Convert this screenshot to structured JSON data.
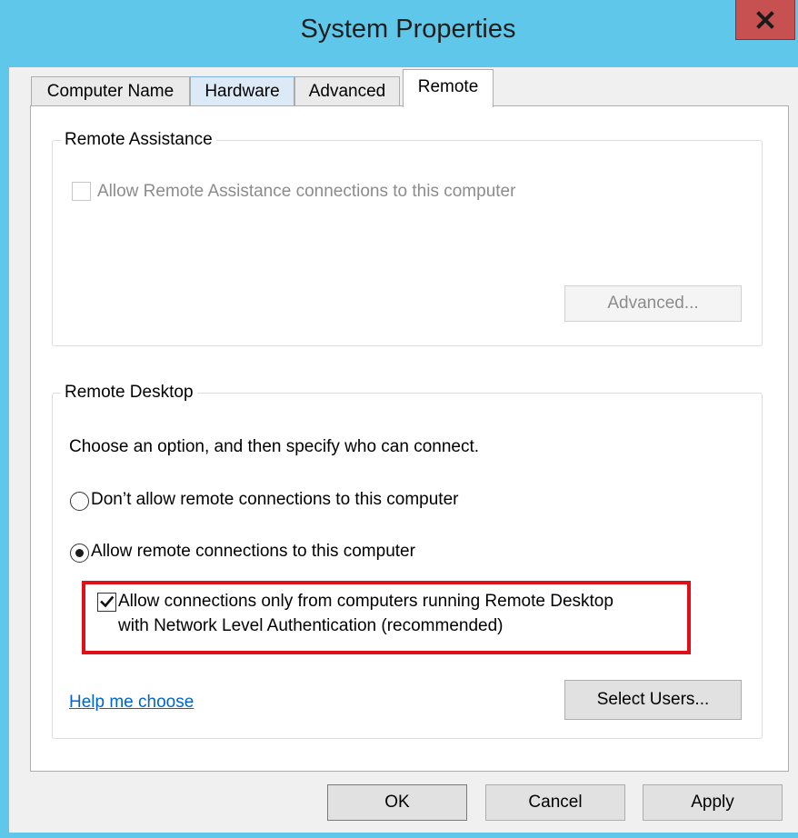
{
  "window": {
    "title": "System Properties",
    "close_icon": "close-icon",
    "accent_color": "#5fc8ea",
    "close_color": "#c75050"
  },
  "tabs": [
    {
      "label": "Computer Name",
      "state": "normal"
    },
    {
      "label": "Hardware",
      "state": "hover"
    },
    {
      "label": "Advanced",
      "state": "normal"
    },
    {
      "label": "Remote",
      "state": "selected"
    }
  ],
  "remote_assistance": {
    "group_label": "Remote Assistance",
    "allow_label": "Allow Remote Assistance connections to this computer",
    "allow_checked": false,
    "allow_enabled": false,
    "advanced_button": "Advanced..."
  },
  "remote_desktop": {
    "group_label": "Remote Desktop",
    "instruction": "Choose an option, and then specify who can connect.",
    "option_dont_allow": "Don’t allow remote connections to this computer",
    "option_allow": "Allow remote connections to this computer",
    "selected_option": "allow",
    "nla_line1": "Allow connections only from computers running Remote Desktop",
    "nla_line2": "with Network Level Authentication (recommended)",
    "nla_checked": true,
    "highlight_color": "#e0101a",
    "help_link": "Help me choose",
    "select_users_button": "Select Users..."
  },
  "footer": {
    "ok": "OK",
    "cancel": "Cancel",
    "apply": "Apply"
  }
}
